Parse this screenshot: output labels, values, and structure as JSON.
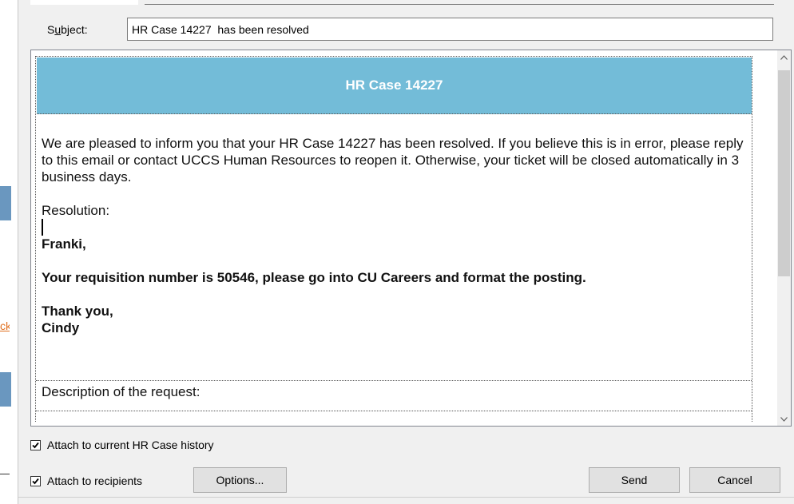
{
  "subject": {
    "label": "Subject:",
    "label_underline_char": "u",
    "value": "HR Case 14227  has been resolved"
  },
  "email": {
    "header_title": "HR Case 14227",
    "intro": "We are pleased to inform you that your HR Case 14227 has been resolved.  If you believe this is in error, please reply to this email or contact UCCS Human Resources to reopen it.  Otherwise, your ticket will be closed automatically in 3 business days.",
    "resolution_label": "Resolution:",
    "greeting": "Franki,",
    "message": "Your requisition number is 50546, please go into CU Careers and format the posting.",
    "signoff": "Thank you,",
    "signature": "Cindy",
    "description_label": "Description of the request:"
  },
  "options": {
    "attach_history_label": "Attach to current HR Case history",
    "attach_history_checked": true,
    "attach_recipients_label": "Attach to recipients",
    "attach_recipients_checked": true
  },
  "buttons": {
    "options_label": "Options...",
    "send_label": "Send",
    "cancel_label": "Cancel"
  },
  "background": {
    "link_fragment": "ck"
  },
  "colors": {
    "header_bg": "#73bcd8",
    "link": "#e07020"
  }
}
